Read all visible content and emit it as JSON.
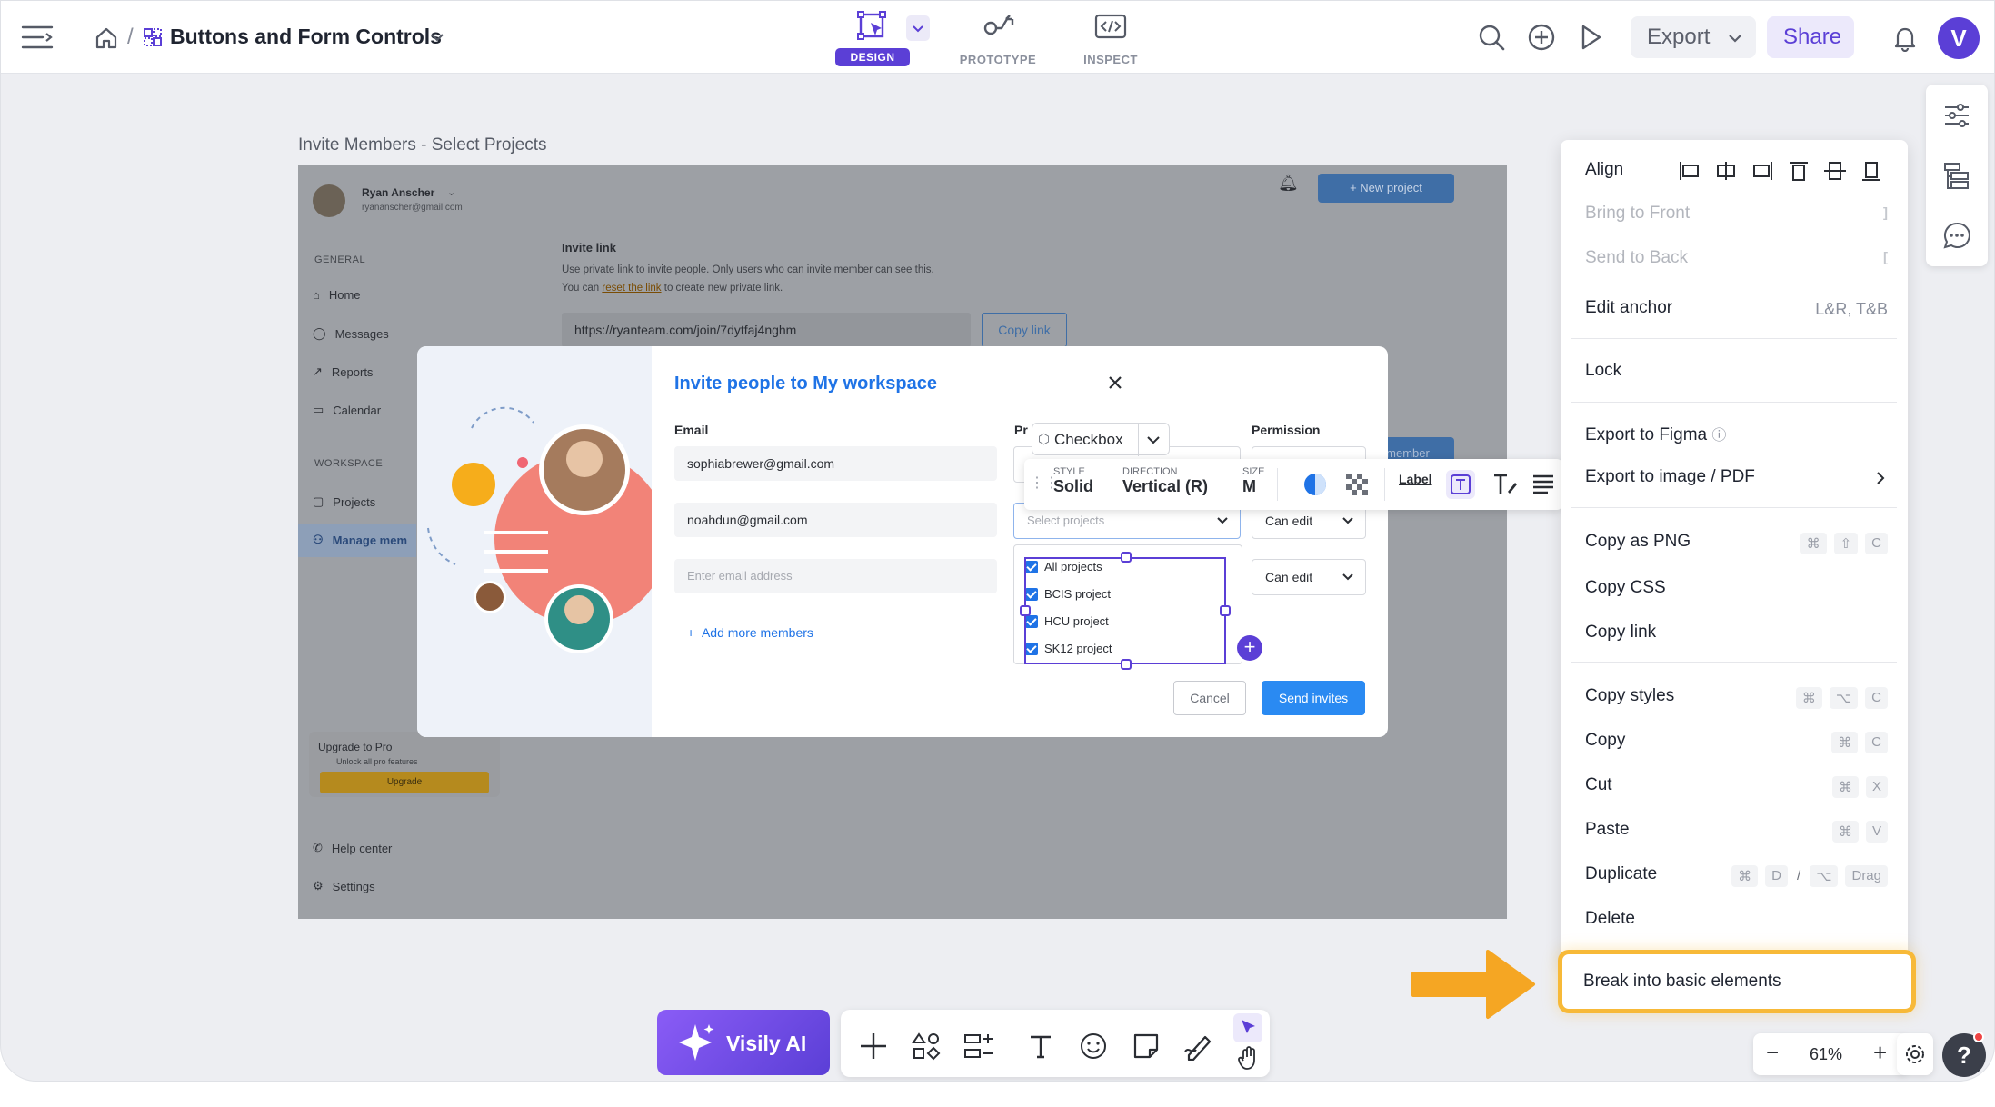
{
  "header": {
    "breadcrumb_title": "Buttons and Form Controls",
    "export_label": "Export",
    "share_label": "Share",
    "avatar_letter": "V"
  },
  "modes": [
    {
      "label": "DESIGN"
    },
    {
      "label": "PROTOTYPE"
    },
    {
      "label": "INSPECT"
    }
  ],
  "canvas": {
    "frame_title": "Invite Members - Select Projects"
  },
  "app_sidebar": {
    "user_name": "Ryan Anscher",
    "user_email": "ryananscher@gmail.com",
    "section_general": "GENERAL",
    "items": [
      "Home",
      "Messages",
      "Reports",
      "Calendar"
    ],
    "section_workspace": "WORKSPACE",
    "ws_items": [
      "Projects",
      "Manage mem"
    ],
    "upgrade_title": "Upgrade to Pro",
    "upgrade_sub": "Unlock all pro features",
    "upgrade_btn": "Upgrade",
    "help": "Help center",
    "settings": "Settings"
  },
  "app_main": {
    "new_project": "New project",
    "invite_link_title": "Invite link",
    "invite_desc1": "Use private link to invite people. Only users who can invite member can see this.",
    "invite_desc2_a": "You can",
    "invite_desc2_link": "reset the link",
    "invite_desc2_b": "to create new private link.",
    "link_url": "https://ryanteam.com/join/7dytfaj4nghm",
    "copy_link": "Copy link",
    "member_tab": "member"
  },
  "modal": {
    "title": "Invite people to My workspace",
    "email_label": "Email",
    "projects_label": "Pr",
    "permission_label": "Permission",
    "emails": [
      "sophiabrewer@gmail.com",
      "noahdun@gmail.com"
    ],
    "email_placeholder": "Enter email address",
    "add_more": "Add more members",
    "select_placeholder": "Select projects",
    "perm_values": [
      "Can edit",
      "Can edit"
    ],
    "options": [
      "All projects",
      "BCIS project",
      "HCU project",
      "SK12 project"
    ],
    "cancel": "Cancel",
    "send": "Send invites"
  },
  "component_toolbar": {
    "component_name": "Checkbox",
    "style_label": "STYLE",
    "style_value": "Solid",
    "direction_label": "DIRECTION",
    "direction_value": "Vertical (R)",
    "size_label": "SIZE",
    "size_value": "M",
    "label_btn": "Label"
  },
  "context_menu": {
    "align": "Align",
    "bring_front": "Bring to Front",
    "bring_front_sc": "]",
    "send_back": "Send to Back",
    "send_back_sc": "[",
    "edit_anchor": "Edit anchor",
    "edit_anchor_val": "L&R, T&B",
    "lock": "Lock",
    "export_figma": "Export to Figma",
    "export_image": "Export to image / PDF",
    "copy_png": "Copy as PNG",
    "copy_css": "Copy CSS",
    "copy_link": "Copy link",
    "copy_styles": "Copy styles",
    "copy": "Copy",
    "cut": "Cut",
    "paste": "Paste",
    "duplicate": "Duplicate",
    "dup_sep": "/",
    "dup_drag": "Drag",
    "delete": "Delete",
    "break": "Break into basic elements",
    "keys": {
      "cmd": "⌘",
      "shift": "⇧",
      "opt": "⌥",
      "c": "C",
      "x": "X",
      "v": "V",
      "d": "D"
    }
  },
  "bottom": {
    "visily_ai": "Visily AI",
    "zoom": "61%",
    "help": "?"
  },
  "colors": {
    "accent": "#5b3fd6",
    "blue": "#1f73e6",
    "highlight": "#f7b938",
    "arrow": "#f5a623"
  }
}
